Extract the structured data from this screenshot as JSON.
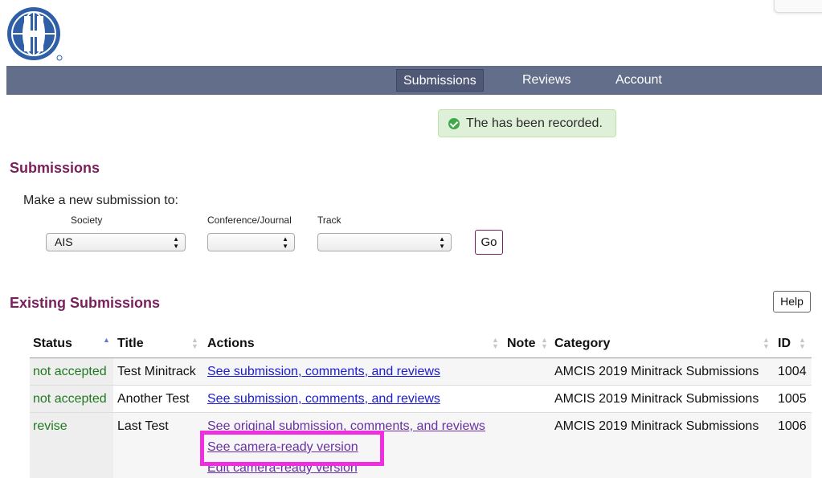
{
  "nav": {
    "items": [
      {
        "label": "Submissions",
        "active": true
      },
      {
        "label": "Reviews",
        "active": false
      },
      {
        "label": "Account",
        "active": false
      }
    ]
  },
  "flash": {
    "message": "The has been recorded."
  },
  "submissions": {
    "heading": "Submissions",
    "make_new_label": "Make a new submission to:",
    "society": {
      "label": "Society",
      "value": "AIS"
    },
    "conference": {
      "label": "Conference/Journal",
      "value": ""
    },
    "track": {
      "label": "Track",
      "value": ""
    },
    "go_label": "Go"
  },
  "existing": {
    "heading": "Existing Submissions",
    "help_label": "Help",
    "columns": [
      "Status",
      "Title",
      "Actions",
      "Note",
      "Category",
      "ID"
    ],
    "rows": [
      {
        "status": "not accepted",
        "title": "Test Minitrack",
        "actions": [
          "See submission, comments, and reviews"
        ],
        "note": "",
        "category": "AMCIS 2019 Minitrack Submissions",
        "id": "1004"
      },
      {
        "status": "not accepted",
        "title": "Another Test",
        "actions": [
          "See submission, comments, and reviews"
        ],
        "note": "",
        "category": "AMCIS 2019 Minitrack Submissions",
        "id": "1005"
      },
      {
        "status": "revise",
        "title": "Last Test",
        "actions": [
          "See original submission, comments, and reviews",
          "See camera-ready version",
          "Edit camera-ready version"
        ],
        "note": "",
        "category": "AMCIS 2019 Minitrack Submissions",
        "id": "1006"
      }
    ]
  },
  "colors": {
    "nav_bg": "#636e8a",
    "heading": "#7a1f5c",
    "status_green": "#1f7a1f",
    "link": "#1a1ad6",
    "highlight": "#ef2fdf",
    "success_bg": "#dff0d8"
  }
}
